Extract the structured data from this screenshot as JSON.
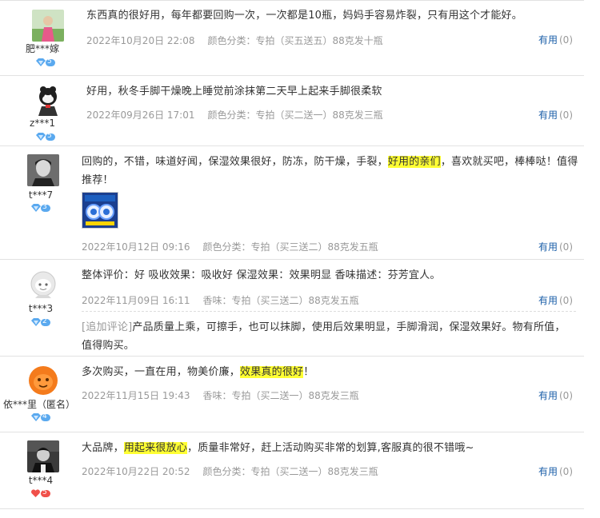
{
  "reviews": [
    {
      "username": "肥***嫁",
      "vip_level": "5",
      "text": "东西真的很好用，每年都要回购一次，一次都是10瓶，妈妈手容易炸裂，只有用这个才能好。",
      "date": "2022年10月20日 22:08",
      "sku": "颜色分类：专拍（买五送五）88克发十瓶",
      "helpful_label": "有用",
      "helpful_count": "(0)"
    },
    {
      "username": "z***1",
      "vip_level": "5",
      "text": "好用，秋冬手脚干燥晚上睡觉前涂抹第二天早上起来手脚很柔软",
      "date": "2022年09月26日 17:01",
      "sku": "颜色分类：专拍（买二送一）88克发三瓶",
      "helpful_label": "有用",
      "helpful_count": "(0)"
    },
    {
      "username": "t***7",
      "vip_level": "3",
      "text_pre": "回购的，不错，味道好闻，保湿效果很好，防冻，防干燥，手裂，",
      "text_hl": "好用的亲们",
      "text_post": "，喜欢就买吧，棒棒哒！值得推荐！",
      "date": "2022年10月12日 09:16",
      "sku": "颜色分类：专拍（买三送二）88克发五瓶",
      "helpful_label": "有用",
      "helpful_count": "(0)"
    },
    {
      "username": "t***3",
      "vip_level": "2",
      "text": "整体评价：好 吸收效果：吸收好 保湿效果：效果明显 香味描述：芬芳宜人。",
      "date": "2022年11月09日 16:11",
      "sku": "香味：专拍（买三送二）88克发五瓶",
      "helpful_label": "有用",
      "helpful_count": "(0)",
      "append_tag": "[追加评论]",
      "append_text": "产品质量上乘，可擦手，也可以抹脚，使用后效果明显，手脚滑润，保湿效果好。物有所值，值得购买。"
    },
    {
      "username": "依***里（匿名）",
      "vip_level": "4",
      "text_pre": "多次购买，一直在用，物美价廉，",
      "text_hl": "效果真的很好",
      "text_post": "！",
      "date": "2022年11月15日 19:43",
      "sku": "香味：专拍（买二送一）88克发三瓶",
      "helpful_label": "有用",
      "helpful_count": "(0)"
    },
    {
      "username": "t***4",
      "vip_level": "5",
      "text_pre": "大品牌，",
      "text_hl": "用起来很放心",
      "text_post": "，质量非常好，赶上活动购买非常的划算,客服真的很不错哦~",
      "date": "2022年10月22日 20:52",
      "sku": "颜色分类：专拍（买二送一）88克发三瓶",
      "helpful_label": "有用",
      "helpful_count": "(0)"
    }
  ],
  "colors": {
    "link": "#1a5ea8",
    "muted": "#999999",
    "highlight": "#ffff33",
    "vip_blue": "#5aa9ef",
    "vip_red": "#f0504a"
  }
}
